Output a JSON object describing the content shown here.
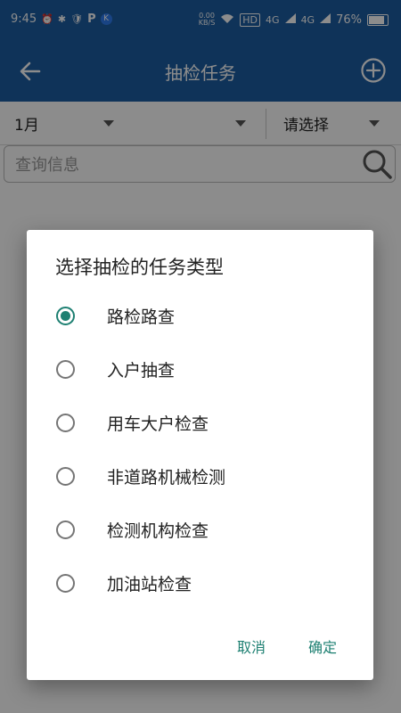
{
  "status_bar": {
    "time": "9:45",
    "speed_value": "0.00",
    "speed_unit": "KB/S",
    "hd": "HD",
    "net1": "4G",
    "net2": "4G",
    "battery": "76%",
    "badge_p": "P",
    "badge_k": "K"
  },
  "app_bar": {
    "title": "抽检任务"
  },
  "filters": {
    "month": "1月",
    "middle": "",
    "select_placeholder": "请选择"
  },
  "search": {
    "placeholder": "查询信息"
  },
  "dialog": {
    "title": "选择抽检的任务类型",
    "options": [
      {
        "label": "路检路查",
        "checked": true
      },
      {
        "label": "入户抽查",
        "checked": false
      },
      {
        "label": "用车大户检查",
        "checked": false
      },
      {
        "label": "非道路机械检测",
        "checked": false
      },
      {
        "label": "检测机构检查",
        "checked": false
      },
      {
        "label": "加油站检查",
        "checked": false
      }
    ],
    "cancel_label": "取消",
    "confirm_label": "确定"
  },
  "colors": {
    "primary": "#1d5ea3",
    "accent": "#1e8072"
  }
}
